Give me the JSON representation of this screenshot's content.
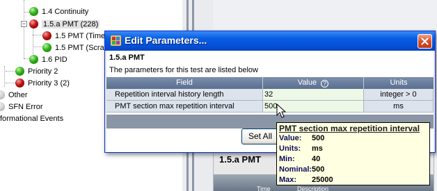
{
  "tree": {
    "items": [
      {
        "label": "1.4 Continuity",
        "status": "green"
      },
      {
        "label": "1.5.a PMT (228)",
        "status": "red"
      },
      {
        "label": "1.5 PMT (Time",
        "status": "red"
      },
      {
        "label": "1.5 PMT (Scra",
        "status": "green"
      },
      {
        "label": "1.6 PID",
        "status": "green"
      },
      {
        "label": "Priority 2",
        "status": "green"
      },
      {
        "label": "Priority 3 (2)",
        "status": "red"
      },
      {
        "label": "Other",
        "status": "grey"
      },
      {
        "label": "SFN Error",
        "status": "grey"
      },
      {
        "label": "formational Events",
        "status": "none"
      }
    ]
  },
  "dialog": {
    "title": "Edit Parameters...",
    "test_name": "1.5.a PMT",
    "description": "The parameters for this test are listed below",
    "columns": {
      "field": "Field",
      "value": "Value",
      "units": "Units"
    },
    "rows": [
      {
        "field": "Repetition interval history length",
        "value": "32",
        "units": "integer > 0"
      },
      {
        "field": "PMT section max repetition interval",
        "value": "500",
        "units": "ms"
      }
    ],
    "set_all_label": "Set All"
  },
  "background_pane": {
    "title": "1.5.a PMT",
    "col_time": "Time",
    "col_description": "Description"
  },
  "tooltip": {
    "title": "PMT section max repetition interval",
    "rows": [
      {
        "key": "Value:",
        "val": "500"
      },
      {
        "key": "Units:",
        "val": "ms"
      },
      {
        "key": "Min:",
        "val": "40"
      },
      {
        "key": "Nominal:",
        "val": "500"
      },
      {
        "key": "Max:",
        "val": "25000"
      }
    ]
  },
  "colors": {
    "title_bar": "#0551d8",
    "grid_header": "#5a6f90",
    "value_cell": "#eef8e6",
    "tooltip_bg": "#ffffe1"
  }
}
